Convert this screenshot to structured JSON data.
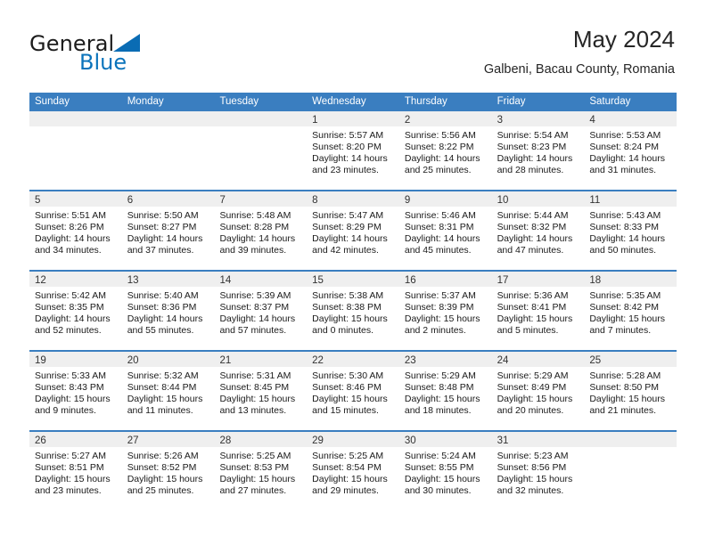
{
  "brand": {
    "line1": "General",
    "line2": "Blue",
    "flag_icon": "triangle-flag-icon",
    "colors": {
      "general": "#1c1c1c",
      "blue": "#0a73bb",
      "flag": "#0a6cb4"
    }
  },
  "header": {
    "title": "May 2024",
    "subtitle": "Galbeni, Bacau County, Romania"
  },
  "theme": {
    "header_blue": "#3a7ec0",
    "day_band_gray": "#efefef",
    "text": "#1a1a1a",
    "background": "#ffffff"
  },
  "calendar": {
    "weekdays": [
      "Sunday",
      "Monday",
      "Tuesday",
      "Wednesday",
      "Thursday",
      "Friday",
      "Saturday"
    ],
    "weeks": [
      [
        {
          "day": "",
          "empty": true
        },
        {
          "day": "",
          "empty": true
        },
        {
          "day": "",
          "empty": true
        },
        {
          "day": "1",
          "sunrise": "Sunrise: 5:57 AM",
          "sunset": "Sunset: 8:20 PM",
          "daylight1": "Daylight: 14 hours",
          "daylight2": "and 23 minutes."
        },
        {
          "day": "2",
          "sunrise": "Sunrise: 5:56 AM",
          "sunset": "Sunset: 8:22 PM",
          "daylight1": "Daylight: 14 hours",
          "daylight2": "and 25 minutes."
        },
        {
          "day": "3",
          "sunrise": "Sunrise: 5:54 AM",
          "sunset": "Sunset: 8:23 PM",
          "daylight1": "Daylight: 14 hours",
          "daylight2": "and 28 minutes."
        },
        {
          "day": "4",
          "sunrise": "Sunrise: 5:53 AM",
          "sunset": "Sunset: 8:24 PM",
          "daylight1": "Daylight: 14 hours",
          "daylight2": "and 31 minutes."
        }
      ],
      [
        {
          "day": "5",
          "sunrise": "Sunrise: 5:51 AM",
          "sunset": "Sunset: 8:26 PM",
          "daylight1": "Daylight: 14 hours",
          "daylight2": "and 34 minutes."
        },
        {
          "day": "6",
          "sunrise": "Sunrise: 5:50 AM",
          "sunset": "Sunset: 8:27 PM",
          "daylight1": "Daylight: 14 hours",
          "daylight2": "and 37 minutes."
        },
        {
          "day": "7",
          "sunrise": "Sunrise: 5:48 AM",
          "sunset": "Sunset: 8:28 PM",
          "daylight1": "Daylight: 14 hours",
          "daylight2": "and 39 minutes."
        },
        {
          "day": "8",
          "sunrise": "Sunrise: 5:47 AM",
          "sunset": "Sunset: 8:29 PM",
          "daylight1": "Daylight: 14 hours",
          "daylight2": "and 42 minutes."
        },
        {
          "day": "9",
          "sunrise": "Sunrise: 5:46 AM",
          "sunset": "Sunset: 8:31 PM",
          "daylight1": "Daylight: 14 hours",
          "daylight2": "and 45 minutes."
        },
        {
          "day": "10",
          "sunrise": "Sunrise: 5:44 AM",
          "sunset": "Sunset: 8:32 PM",
          "daylight1": "Daylight: 14 hours",
          "daylight2": "and 47 minutes."
        },
        {
          "day": "11",
          "sunrise": "Sunrise: 5:43 AM",
          "sunset": "Sunset: 8:33 PM",
          "daylight1": "Daylight: 14 hours",
          "daylight2": "and 50 minutes."
        }
      ],
      [
        {
          "day": "12",
          "sunrise": "Sunrise: 5:42 AM",
          "sunset": "Sunset: 8:35 PM",
          "daylight1": "Daylight: 14 hours",
          "daylight2": "and 52 minutes."
        },
        {
          "day": "13",
          "sunrise": "Sunrise: 5:40 AM",
          "sunset": "Sunset: 8:36 PM",
          "daylight1": "Daylight: 14 hours",
          "daylight2": "and 55 minutes."
        },
        {
          "day": "14",
          "sunrise": "Sunrise: 5:39 AM",
          "sunset": "Sunset: 8:37 PM",
          "daylight1": "Daylight: 14 hours",
          "daylight2": "and 57 minutes."
        },
        {
          "day": "15",
          "sunrise": "Sunrise: 5:38 AM",
          "sunset": "Sunset: 8:38 PM",
          "daylight1": "Daylight: 15 hours",
          "daylight2": "and 0 minutes."
        },
        {
          "day": "16",
          "sunrise": "Sunrise: 5:37 AM",
          "sunset": "Sunset: 8:39 PM",
          "daylight1": "Daylight: 15 hours",
          "daylight2": "and 2 minutes."
        },
        {
          "day": "17",
          "sunrise": "Sunrise: 5:36 AM",
          "sunset": "Sunset: 8:41 PM",
          "daylight1": "Daylight: 15 hours",
          "daylight2": "and 5 minutes."
        },
        {
          "day": "18",
          "sunrise": "Sunrise: 5:35 AM",
          "sunset": "Sunset: 8:42 PM",
          "daylight1": "Daylight: 15 hours",
          "daylight2": "and 7 minutes."
        }
      ],
      [
        {
          "day": "19",
          "sunrise": "Sunrise: 5:33 AM",
          "sunset": "Sunset: 8:43 PM",
          "daylight1": "Daylight: 15 hours",
          "daylight2": "and 9 minutes."
        },
        {
          "day": "20",
          "sunrise": "Sunrise: 5:32 AM",
          "sunset": "Sunset: 8:44 PM",
          "daylight1": "Daylight: 15 hours",
          "daylight2": "and 11 minutes."
        },
        {
          "day": "21",
          "sunrise": "Sunrise: 5:31 AM",
          "sunset": "Sunset: 8:45 PM",
          "daylight1": "Daylight: 15 hours",
          "daylight2": "and 13 minutes."
        },
        {
          "day": "22",
          "sunrise": "Sunrise: 5:30 AM",
          "sunset": "Sunset: 8:46 PM",
          "daylight1": "Daylight: 15 hours",
          "daylight2": "and 15 minutes."
        },
        {
          "day": "23",
          "sunrise": "Sunrise: 5:29 AM",
          "sunset": "Sunset: 8:48 PM",
          "daylight1": "Daylight: 15 hours",
          "daylight2": "and 18 minutes."
        },
        {
          "day": "24",
          "sunrise": "Sunrise: 5:29 AM",
          "sunset": "Sunset: 8:49 PM",
          "daylight1": "Daylight: 15 hours",
          "daylight2": "and 20 minutes."
        },
        {
          "day": "25",
          "sunrise": "Sunrise: 5:28 AM",
          "sunset": "Sunset: 8:50 PM",
          "daylight1": "Daylight: 15 hours",
          "daylight2": "and 21 minutes."
        }
      ],
      [
        {
          "day": "26",
          "sunrise": "Sunrise: 5:27 AM",
          "sunset": "Sunset: 8:51 PM",
          "daylight1": "Daylight: 15 hours",
          "daylight2": "and 23 minutes."
        },
        {
          "day": "27",
          "sunrise": "Sunrise: 5:26 AM",
          "sunset": "Sunset: 8:52 PM",
          "daylight1": "Daylight: 15 hours",
          "daylight2": "and 25 minutes."
        },
        {
          "day": "28",
          "sunrise": "Sunrise: 5:25 AM",
          "sunset": "Sunset: 8:53 PM",
          "daylight1": "Daylight: 15 hours",
          "daylight2": "and 27 minutes."
        },
        {
          "day": "29",
          "sunrise": "Sunrise: 5:25 AM",
          "sunset": "Sunset: 8:54 PM",
          "daylight1": "Daylight: 15 hours",
          "daylight2": "and 29 minutes."
        },
        {
          "day": "30",
          "sunrise": "Sunrise: 5:24 AM",
          "sunset": "Sunset: 8:55 PM",
          "daylight1": "Daylight: 15 hours",
          "daylight2": "and 30 minutes."
        },
        {
          "day": "31",
          "sunrise": "Sunrise: 5:23 AM",
          "sunset": "Sunset: 8:56 PM",
          "daylight1": "Daylight: 15 hours",
          "daylight2": "and 32 minutes."
        },
        {
          "day": "",
          "empty": true
        }
      ]
    ]
  }
}
